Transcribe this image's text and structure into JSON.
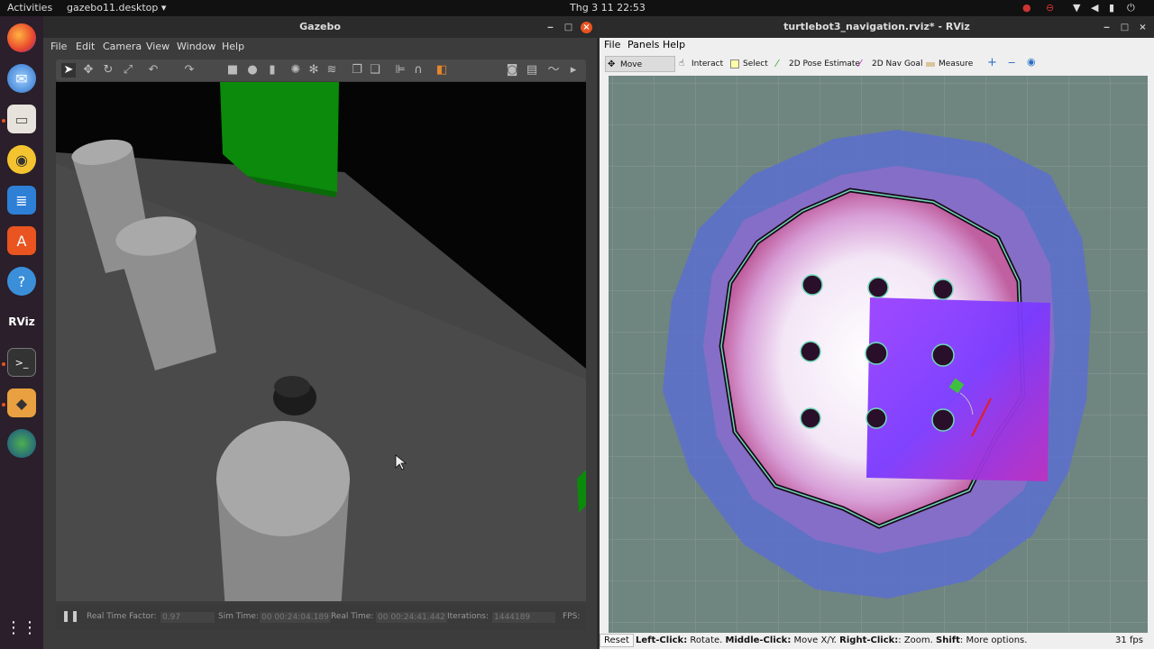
{
  "topbar": {
    "activities": "Activities",
    "app_menu": "gazebo11.desktop ▾",
    "clock": "Thg 3 11  22:53"
  },
  "dock": {
    "items": [
      {
        "name": "firefox-icon"
      },
      {
        "name": "mail-icon"
      },
      {
        "name": "files-icon"
      },
      {
        "name": "rhythmbox-icon"
      },
      {
        "name": "writer-icon"
      },
      {
        "name": "software-icon"
      },
      {
        "name": "help-icon"
      },
      {
        "name": "rviz-icon"
      },
      {
        "name": "terminal-icon"
      },
      {
        "name": "gazebo-icon"
      },
      {
        "name": "globe-icon"
      }
    ],
    "rviz_label": "RViz",
    "terminal_label": ">_",
    "help_label": "?"
  },
  "gazebo": {
    "title": "Gazebo",
    "menu": [
      "File",
      "Edit",
      "Camera",
      "View",
      "Window",
      "Help"
    ],
    "status": {
      "rtf_label": "Real Time Factor:",
      "rtf_value": "0.97",
      "sim_label": "Sim Time:",
      "sim_value": "00 00:24:04.189",
      "real_label": "Real Time:",
      "real_value": "00 00:24:41.442",
      "iter_label": "Iterations:",
      "iter_value": "1444189",
      "fps_label": "FPS:"
    }
  },
  "rviz": {
    "title": "turtlebot3_navigation.rviz* - RViz",
    "menu": [
      "File",
      "Panels",
      "Help"
    ],
    "tools": [
      "Move Camera",
      "Interact",
      "Select",
      "2D Pose Estimate",
      "2D Nav Goal",
      "Measure"
    ],
    "reset": "Reset",
    "hint_parts": [
      "Left-Click:",
      " Rotate. ",
      "Middle-Click:",
      " Move X/Y. ",
      "Right-Click:",
      ": Zoom. ",
      "Shift",
      ": More options."
    ],
    "fps": "31 fps"
  },
  "colors": {
    "accent": "#e95420",
    "gazebo_green": "#0b8a0b",
    "rviz_grid": "#6f8580"
  }
}
